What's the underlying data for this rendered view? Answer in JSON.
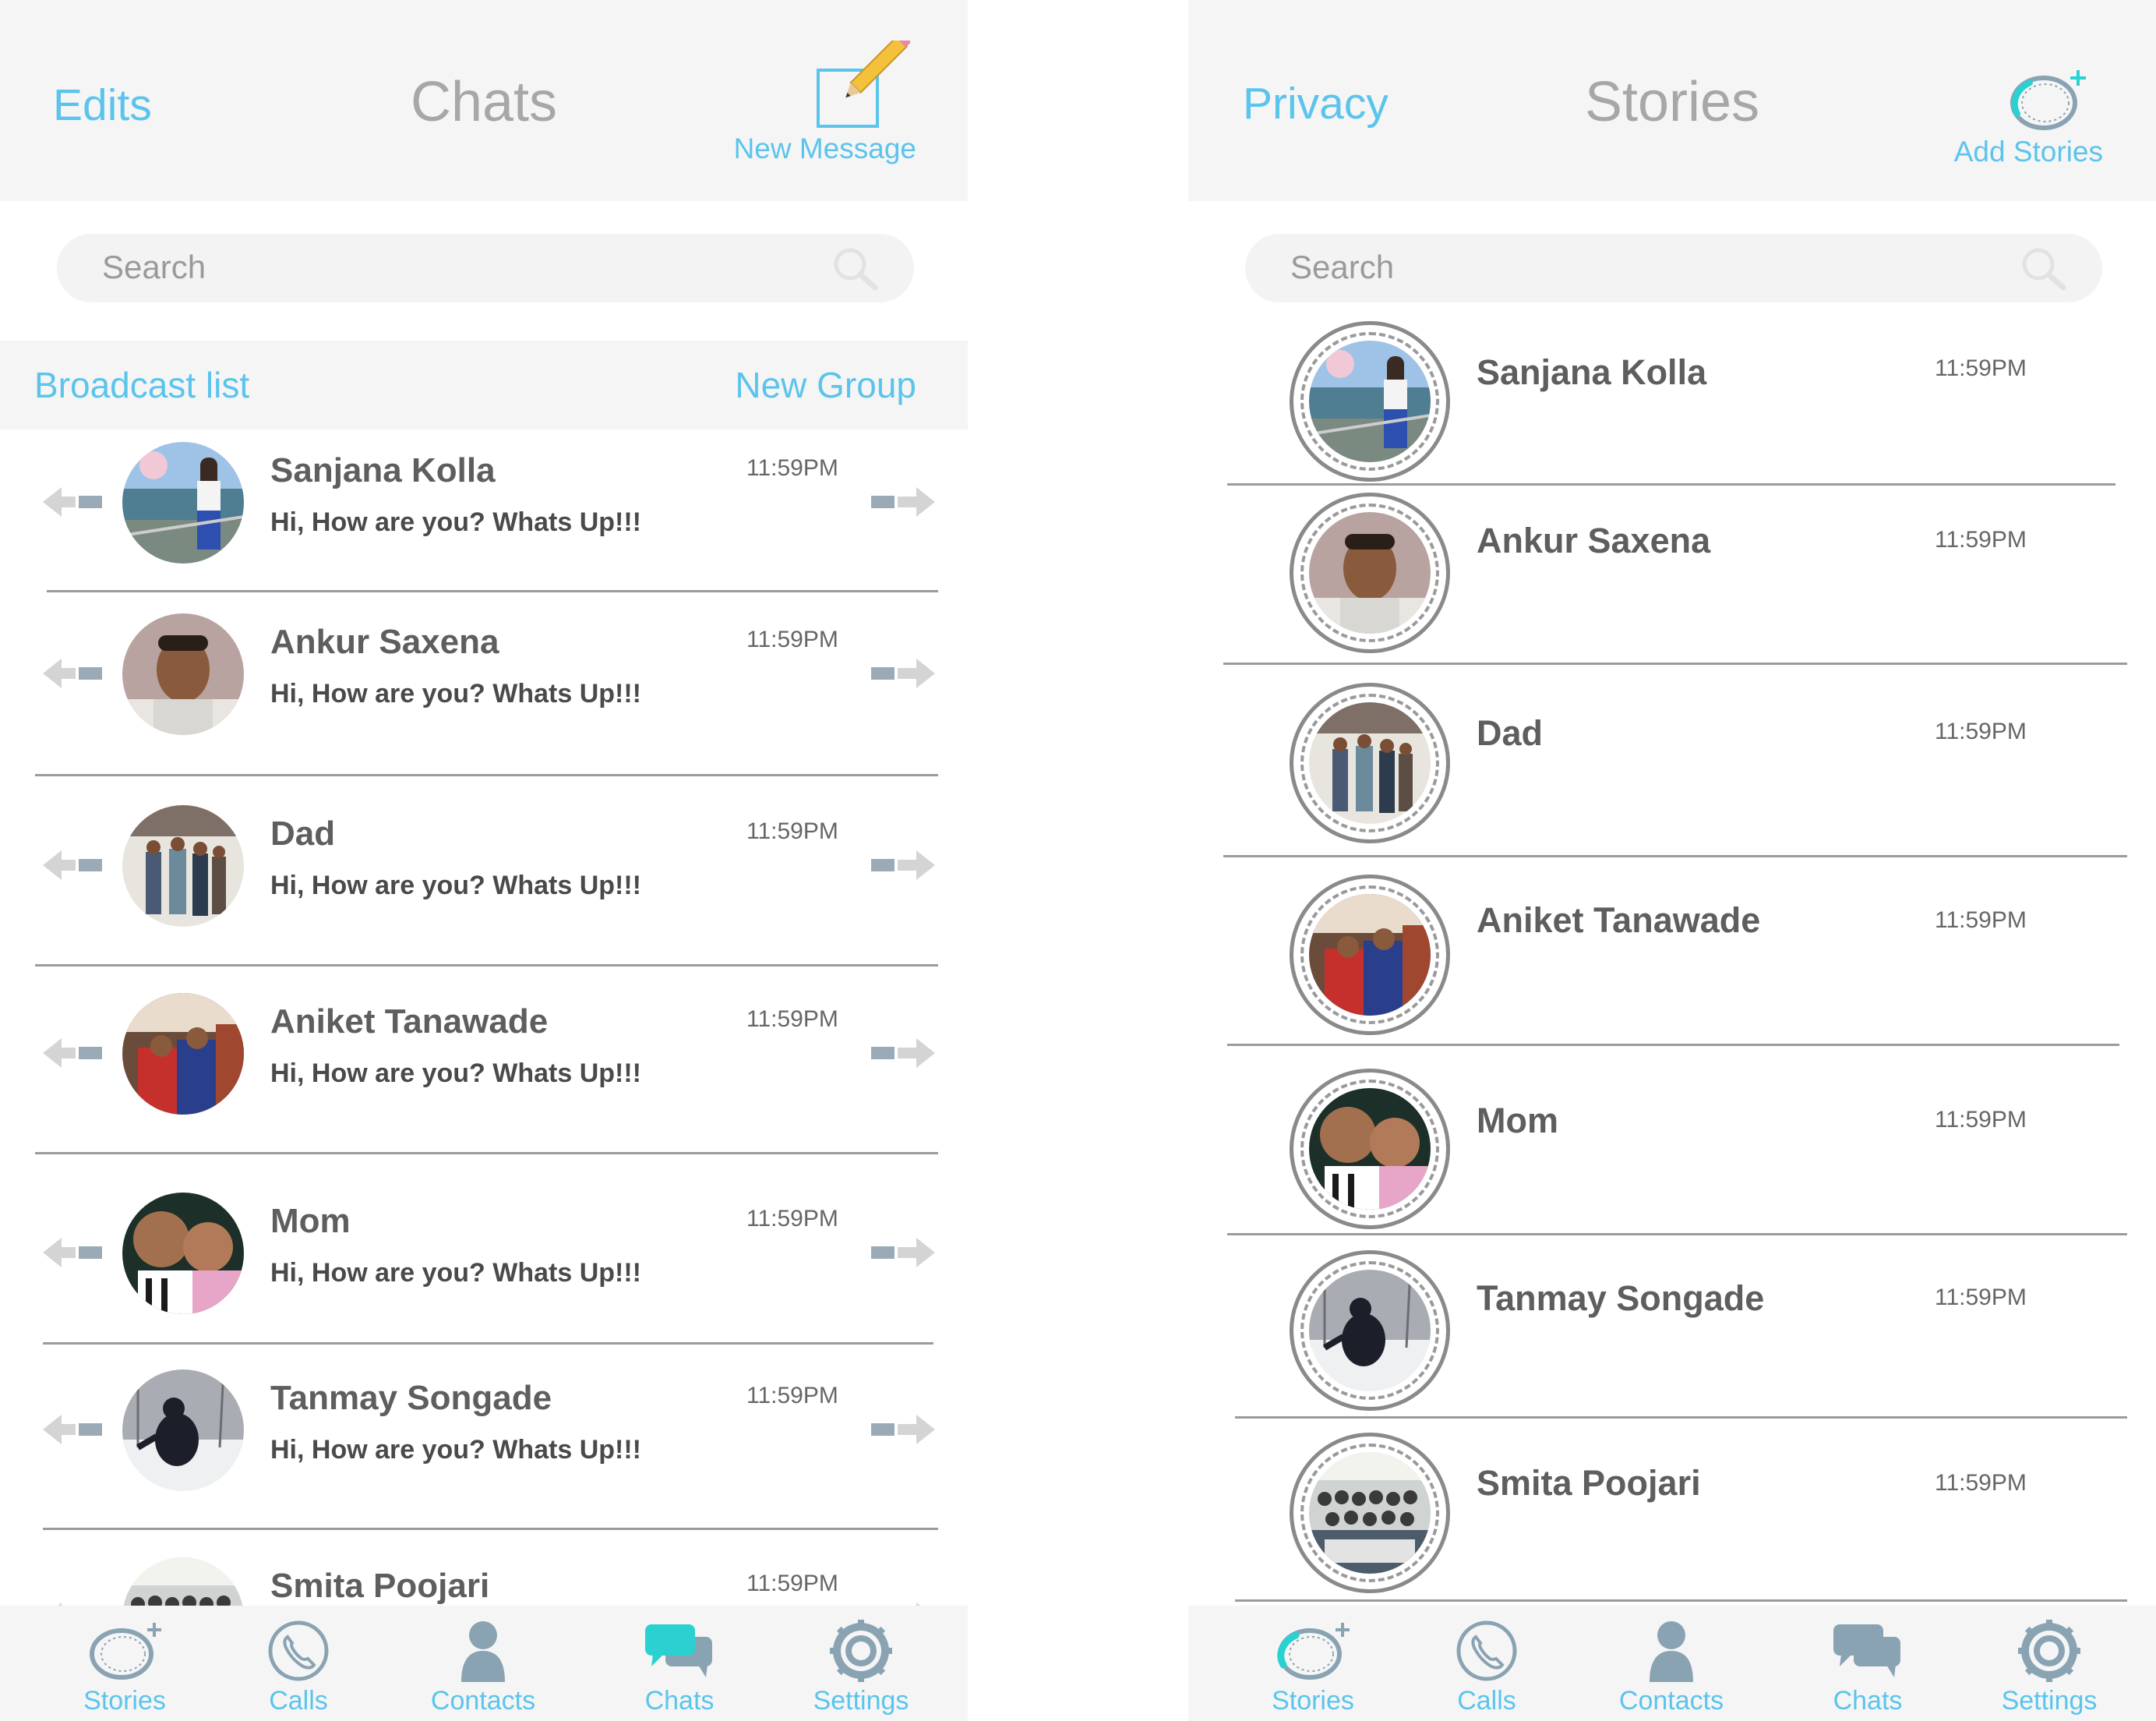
{
  "colors": {
    "accent": "#5bc4ec",
    "active_tab": "#2bd1d1",
    "icon_gray": "#8aa3b3",
    "title_gray": "#a7a7a7",
    "header_bg": "#f5f5f5"
  },
  "chats_screen": {
    "header": {
      "left": "Edits",
      "title": "Chats",
      "right_label": "New Message",
      "right_icon": "compose-icon"
    },
    "search": {
      "placeholder": "Search"
    },
    "sub_bar": {
      "left": "Broadcast list",
      "right": "New Group"
    },
    "chats": [
      {
        "name": "Sanjana Kolla",
        "message": "Hi, How are you? Whats Up!!!",
        "time": "11:59PM"
      },
      {
        "name": "Ankur Saxena",
        "message": "Hi, How are you? Whats Up!!!",
        "time": "11:59PM"
      },
      {
        "name": "Dad",
        "message": "Hi, How are you? Whats Up!!!",
        "time": "11:59PM"
      },
      {
        "name": "Aniket Tanawade",
        "message": "Hi, How are you? Whats Up!!!",
        "time": "11:59PM"
      },
      {
        "name": "Mom",
        "message": "Hi, How are you? Whats Up!!!",
        "time": "11:59PM"
      },
      {
        "name": "Tanmay Songade",
        "message": "Hi, How are you? Whats Up!!!",
        "time": "11:59PM"
      },
      {
        "name": "Smita Poojari",
        "message": "",
        "time": "11:59PM"
      }
    ],
    "tabs": [
      {
        "label": "Stories",
        "icon": "stories-icon",
        "active": false
      },
      {
        "label": "Calls",
        "icon": "phone-icon",
        "active": false
      },
      {
        "label": "Contacts",
        "icon": "person-icon",
        "active": false
      },
      {
        "label": "Chats",
        "icon": "chat-bubbles-icon",
        "active": true
      },
      {
        "label": "Settings",
        "icon": "gear-icon",
        "active": false
      }
    ]
  },
  "stories_screen": {
    "header": {
      "left": "Privacy",
      "title": "Stories",
      "right_label": "Add Stories",
      "right_icon": "add-story-icon"
    },
    "search": {
      "placeholder": "Search"
    },
    "stories": [
      {
        "name": "Sanjana Kolla",
        "time": "11:59PM"
      },
      {
        "name": "Ankur Saxena",
        "time": "11:59PM"
      },
      {
        "name": "Dad",
        "time": "11:59PM"
      },
      {
        "name": "Aniket Tanawade",
        "time": "11:59PM"
      },
      {
        "name": "Mom",
        "time": "11:59PM"
      },
      {
        "name": "Tanmay Songade",
        "time": "11:59PM"
      },
      {
        "name": "Smita Poojari",
        "time": "11:59PM"
      }
    ],
    "tabs": [
      {
        "label": "Stories",
        "icon": "stories-icon",
        "active": true
      },
      {
        "label": "Calls",
        "icon": "phone-icon",
        "active": false
      },
      {
        "label": "Contacts",
        "icon": "person-icon",
        "active": false
      },
      {
        "label": "Chats",
        "icon": "chat-bubbles-icon",
        "active": false
      },
      {
        "label": "Settings",
        "icon": "gear-icon",
        "active": false
      }
    ]
  }
}
